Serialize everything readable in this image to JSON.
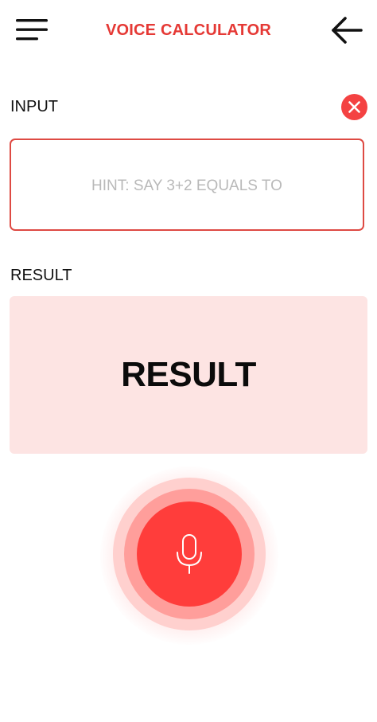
{
  "header": {
    "title": "VOICE CALCULATOR",
    "menu_icon": "hamburger-menu-icon",
    "back_icon": "arrow-left-icon"
  },
  "input_section": {
    "label": "INPUT",
    "clear_icon": "close-icon",
    "hint": "HINT: SAY 3+2 EQUALS TO"
  },
  "result_section": {
    "label": "RESULT",
    "value": "RESULT"
  },
  "mic": {
    "icon": "microphone-icon"
  },
  "colors": {
    "accent": "#e53935",
    "clear_button": "#f44242",
    "input_border": "#de4a43",
    "result_background": "#fde4e3",
    "mic_button": "#ff3d3b",
    "mic_ring_mid": "#ff9e9b",
    "mic_ring_outer": "#ffd0ce"
  }
}
